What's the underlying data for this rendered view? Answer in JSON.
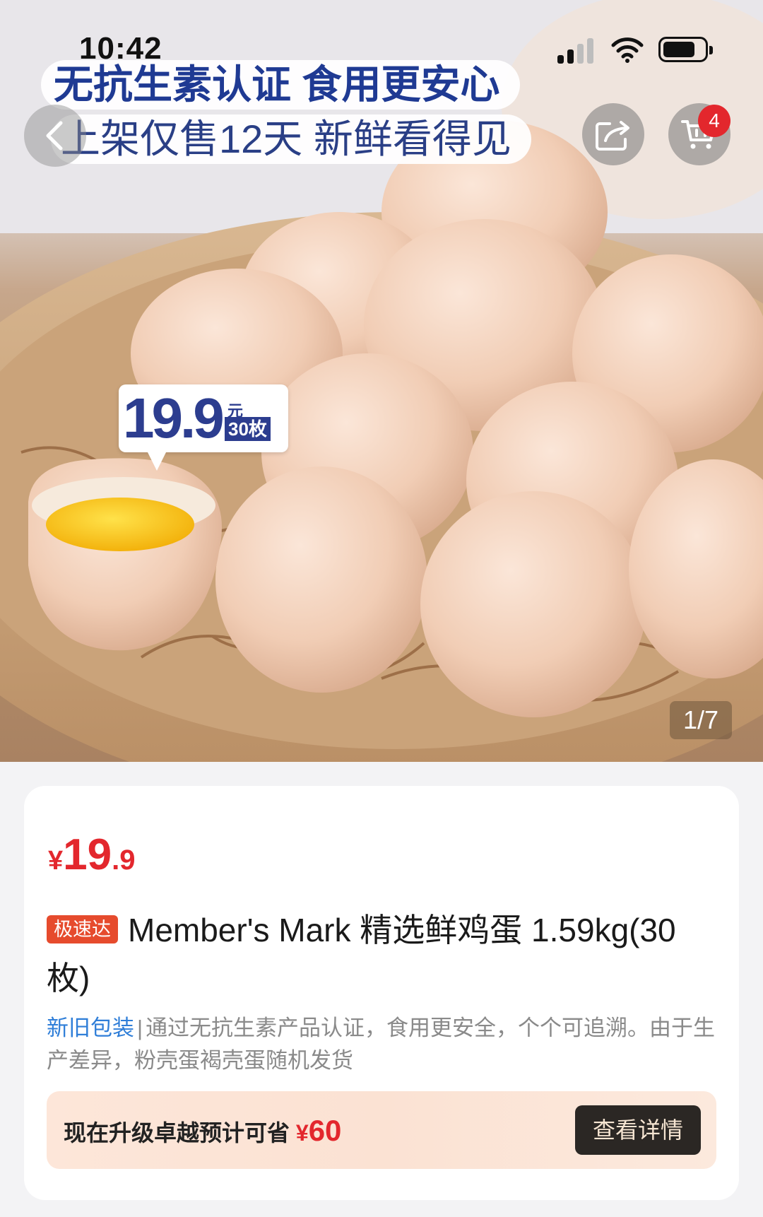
{
  "status_bar": {
    "time": "10:42"
  },
  "hero": {
    "banner_line_1": "无抗生素认证 食用更安心",
    "banner_line_2": "上架仅售12天 新鲜看得见",
    "price_tag": {
      "price": "19.9",
      "unit": "元",
      "count": "30枚"
    },
    "cart_badge_count": "4",
    "page_indicator": "1/7",
    "icons": [
      "back-arrow-icon",
      "share-icon",
      "cart-icon"
    ]
  },
  "product": {
    "price_currency": "¥",
    "price_integer": "19",
    "price_decimal": ".9",
    "express_badge": "极速达",
    "title": "Member's Mark 精选鲜鸡蛋 1.59kg(30枚)",
    "desc_tag": "新旧包装",
    "desc_separator": "|",
    "description": "通过无抗生素产品认证，食用更安全，个个可追溯。由于生产差异，粉壳蛋褐壳蛋随机发货"
  },
  "upgrade": {
    "text": "现在升级卓越预计可省",
    "save_currency": "¥",
    "save_amount": "60",
    "button_label": "查看详情"
  },
  "colors": {
    "price_red": "#e3272d",
    "banner_blue": "#1f3a93",
    "link_blue": "#2f7ed8",
    "button_dark": "#2b2724"
  }
}
